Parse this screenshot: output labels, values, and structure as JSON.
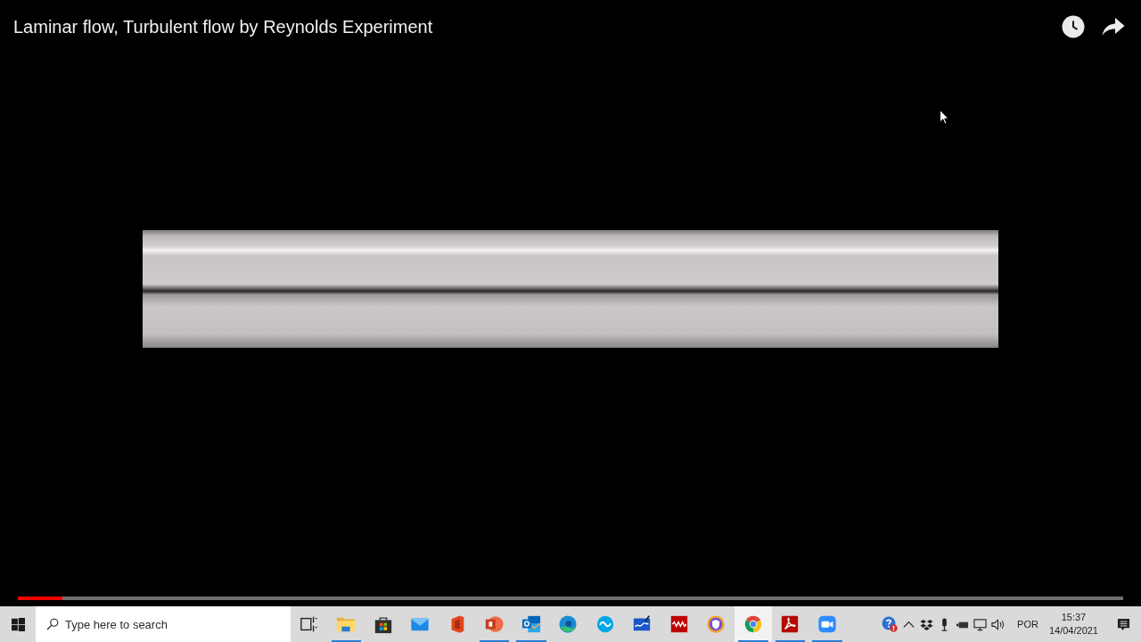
{
  "video": {
    "title": "Laminar flow, Turbulent flow by Reynolds Experiment",
    "progress": {
      "level": 0.04
    }
  },
  "taskbar": {
    "search": {
      "placeholder": "Type here to search"
    },
    "apps": [
      {
        "kind": "taskview",
        "running": false,
        "selected": false
      },
      {
        "kind": "explorer",
        "running": true,
        "selected": false
      },
      {
        "kind": "store",
        "running": false,
        "selected": false
      },
      {
        "kind": "mail",
        "running": false,
        "selected": false
      },
      {
        "kind": "office",
        "running": false,
        "selected": false
      },
      {
        "kind": "powerpoint",
        "running": true,
        "selected": false
      },
      {
        "kind": "outlook",
        "running": true,
        "selected": false
      },
      {
        "kind": "edge",
        "running": false,
        "selected": false
      },
      {
        "kind": "skype",
        "running": false,
        "selected": false
      },
      {
        "kind": "whiteboard",
        "running": false,
        "selected": false
      },
      {
        "kind": "filezilla",
        "running": false,
        "selected": false
      },
      {
        "kind": "vpn",
        "running": false,
        "selected": false
      },
      {
        "kind": "chrome",
        "running": true,
        "selected": true
      },
      {
        "kind": "acrobat",
        "running": true,
        "selected": false
      },
      {
        "kind": "zoom",
        "running": true,
        "selected": false
      }
    ],
    "tray": {
      "language": "POR",
      "time": "15:37",
      "date": "14/04/2021"
    }
  }
}
